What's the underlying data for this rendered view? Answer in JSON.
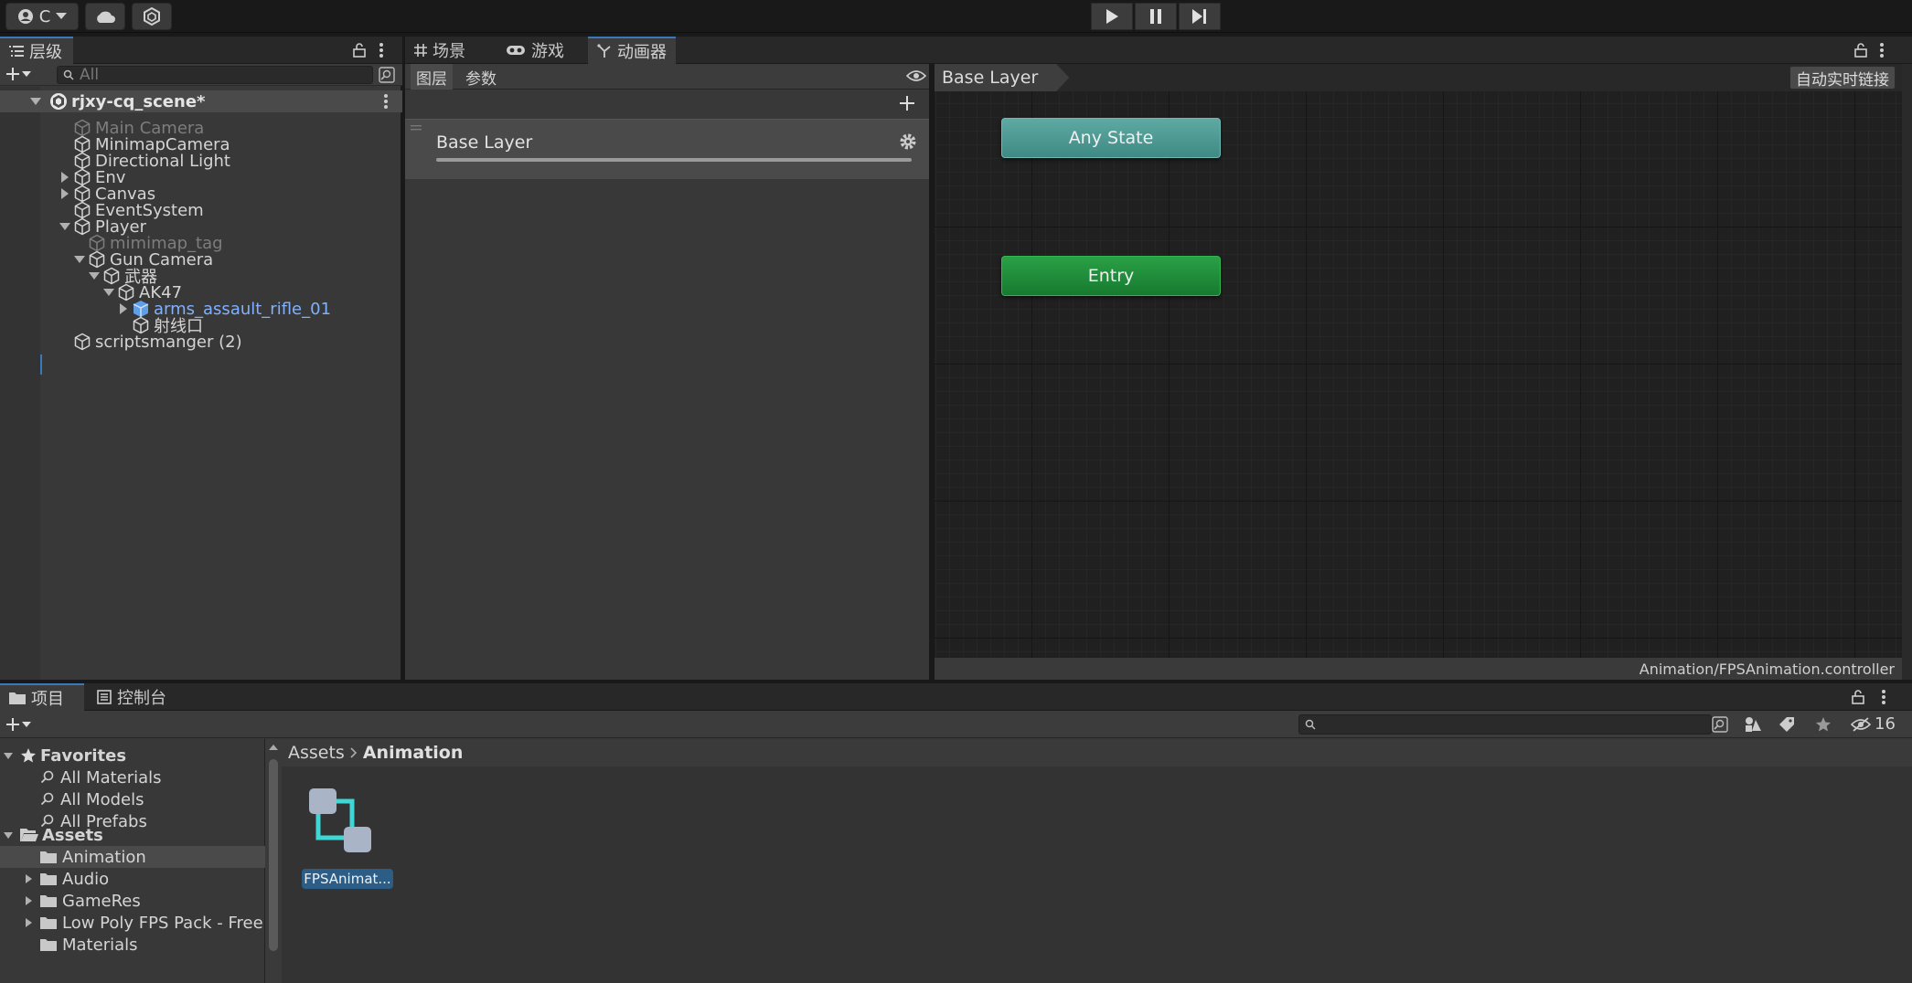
{
  "toolbar": {
    "account_label": "C",
    "play_icon": "play-icon",
    "pause_icon": "pause-icon",
    "step_icon": "step-icon"
  },
  "hierarchy": {
    "tab_label": "层级",
    "search_placeholder": "All",
    "scene_name": "rjxy-cq_scene*",
    "items": [
      {
        "label": "Main Camera",
        "depth": 1,
        "expand": "none",
        "dim": true
      },
      {
        "label": "MinimapCamera",
        "depth": 1,
        "expand": "none"
      },
      {
        "label": "Directional Light",
        "depth": 1,
        "expand": "none"
      },
      {
        "label": "Env",
        "depth": 1,
        "expand": "collapsed"
      },
      {
        "label": "Canvas",
        "depth": 1,
        "expand": "collapsed"
      },
      {
        "label": "EventSystem",
        "depth": 1,
        "expand": "none"
      },
      {
        "label": "Player",
        "depth": 1,
        "expand": "expanded"
      },
      {
        "label": "mimimap_tag",
        "depth": 2,
        "expand": "none",
        "dim": true
      },
      {
        "label": "Gun Camera",
        "depth": 2,
        "expand": "expanded"
      },
      {
        "label": "武器",
        "depth": 3,
        "expand": "expanded"
      },
      {
        "label": "AK47",
        "depth": 4,
        "expand": "expanded"
      },
      {
        "label": "arms_assault_rifle_01",
        "depth": 5,
        "expand": "collapsed",
        "prefab": true
      },
      {
        "label": "射线口",
        "depth": 5,
        "expand": "none"
      },
      {
        "label": "scriptsmanger (2)",
        "depth": 1,
        "expand": "none"
      }
    ]
  },
  "center_tabs": [
    {
      "label": "场景",
      "icon": "grid-icon"
    },
    {
      "label": "游戏",
      "icon": "gamepad-icon"
    },
    {
      "label": "动画器",
      "icon": "animator-icon"
    }
  ],
  "animator": {
    "subtab_layers": "图层",
    "subtab_params": "参数",
    "layer_name": "Base Layer",
    "breadcrumb": "Base Layer",
    "live_link_button": "自动实时链接",
    "nodes": {
      "any_state": "Any State",
      "entry": "Entry"
    },
    "controller_path": "Animation/FPSAnimation.controller"
  },
  "project": {
    "tabs": [
      "项目",
      "控制台"
    ],
    "hidden_count": "16",
    "favorites_label": "Favorites",
    "favorites": [
      "All Materials",
      "All Models",
      "All Prefabs"
    ],
    "assets_label": "Assets",
    "folders": [
      {
        "label": "Animation",
        "selected": true,
        "expand": "none"
      },
      {
        "label": "Audio",
        "expand": "collapsed"
      },
      {
        "label": "GameRes",
        "expand": "collapsed"
      },
      {
        "label": "Low Poly FPS Pack - Free",
        "expand": "collapsed"
      },
      {
        "label": "Materials",
        "expand": "none"
      }
    ],
    "breadcrumb_root": "Assets",
    "breadcrumb_current": "Animation",
    "asset_label": "FPSAnimat..."
  },
  "colors": {
    "accent": "#3a79bb",
    "any_state": "#4c9a95",
    "entry": "#1e8a3a",
    "selection": "#2c5d87"
  }
}
